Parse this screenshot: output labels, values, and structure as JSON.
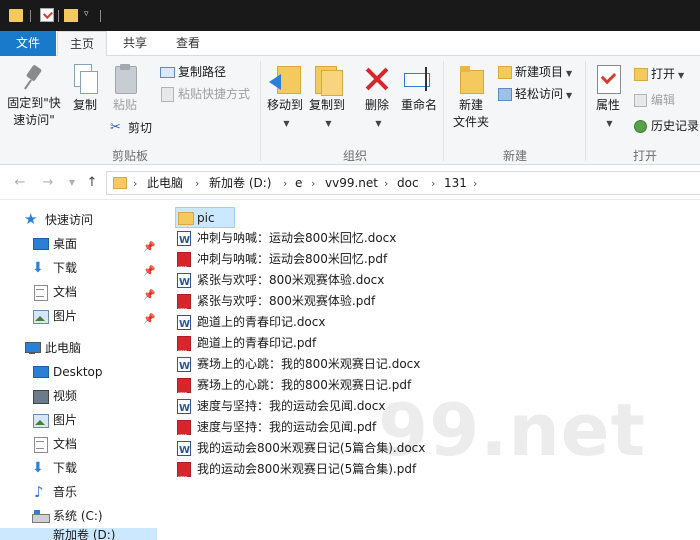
{
  "ribbon_tabs": {
    "file": "文件",
    "home": "主页",
    "share": "共享",
    "view": "查看"
  },
  "clipboard": {
    "pin": "固定到\"快\n速访问\"",
    "pin_line1": "固定到\"快",
    "pin_line2": "速访问\"",
    "copy": "复制",
    "paste": "粘贴",
    "copy_path": "复制路径",
    "paste_shortcut": "粘贴快捷方式",
    "cut": "剪切",
    "group_label": "剪贴板"
  },
  "organize": {
    "move_to": "移动到",
    "copy_to": "复制到",
    "delete": "删除",
    "rename": "重命名",
    "group_label": "组织"
  },
  "new_group": {
    "new_folder_line1": "新建",
    "new_folder_line2": "文件夹",
    "new_item": "新建项目",
    "easy_access": "轻松访问",
    "group_label": "新建"
  },
  "open_group": {
    "properties": "属性",
    "open": "打开",
    "edit": "编辑",
    "history": "历史记录",
    "group_label": "打开"
  },
  "breadcrumb": [
    "此电脑",
    "新加卷 (D:)",
    "e",
    "vv99.net",
    "doc",
    "131"
  ],
  "nav_pane": {
    "quick_access": "快速访问",
    "quick_items": [
      "桌面",
      "下载",
      "文档",
      "图片"
    ],
    "this_pc": "此电脑",
    "pc_items": [
      "Desktop",
      "视频",
      "图片",
      "文档",
      "下载",
      "音乐",
      "系统 (C:)"
    ],
    "partial_item": "新加卷 (D:)"
  },
  "files": [
    {
      "name": "pic",
      "type": "folder"
    },
    {
      "name": "冲刺与呐喊：运动会800米回忆.docx",
      "type": "docx"
    },
    {
      "name": "冲刺与呐喊：运动会800米回忆.pdf",
      "type": "pdf"
    },
    {
      "name": "紧张与欢呼：800米观赛体验.docx",
      "type": "docx"
    },
    {
      "name": "紧张与欢呼：800米观赛体验.pdf",
      "type": "pdf"
    },
    {
      "name": "跑道上的青春印记.docx",
      "type": "docx"
    },
    {
      "name": "跑道上的青春印记.pdf",
      "type": "pdf"
    },
    {
      "name": "赛场上的心跳：我的800米观赛日记.docx",
      "type": "docx"
    },
    {
      "name": "赛场上的心跳：我的800米观赛日记.pdf",
      "type": "pdf"
    },
    {
      "name": "速度与坚持：我的运动会见闻.docx",
      "type": "docx"
    },
    {
      "name": "速度与坚持：我的运动会见闻.pdf",
      "type": "pdf"
    },
    {
      "name": "我的运动会800米观赛日记(5篇合集).docx",
      "type": "docx"
    },
    {
      "name": "我的运动会800米观赛日记(5篇合集).pdf",
      "type": "pdf"
    }
  ],
  "watermark": "99.net",
  "colors": {
    "accent": "#1979ca",
    "selection": "#cce8ff",
    "folder": "#f4c95d",
    "pdf": "#d8262c",
    "word": "#2b5797"
  }
}
